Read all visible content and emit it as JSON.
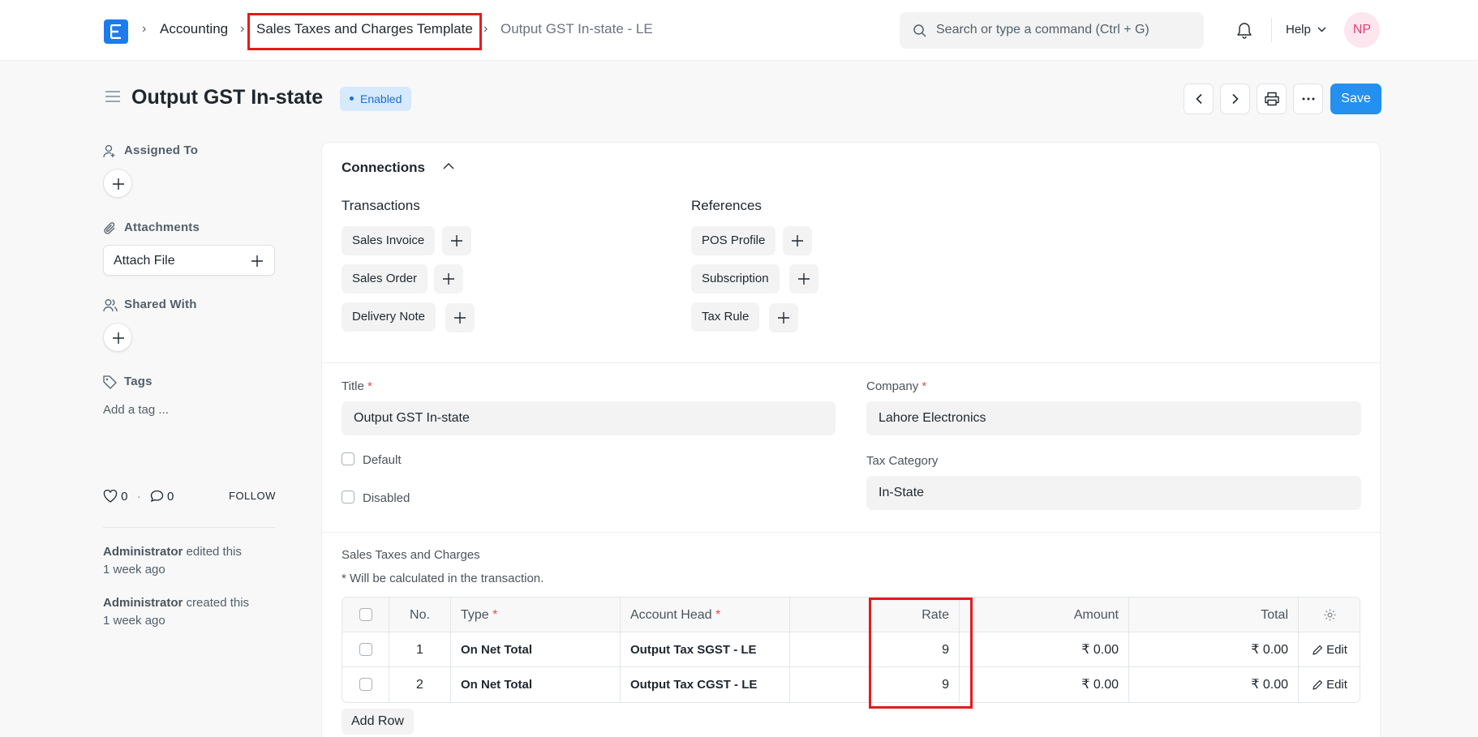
{
  "navbar": {
    "breadcrumbs": [
      "Accounting",
      "Sales Taxes and Charges Template",
      "Output GST In-state - LE"
    ],
    "search_placeholder": "Search or type a command (Ctrl + G)",
    "help_label": "Help",
    "avatar_initials": "NP"
  },
  "header": {
    "title": "Output GST In-state",
    "status": "Enabled",
    "save_label": "Save"
  },
  "sidebar": {
    "assigned_to": "Assigned To",
    "attachments": "Attachments",
    "attach_file": "Attach File",
    "shared_with": "Shared With",
    "tags": "Tags",
    "add_tag": "Add a tag ...",
    "likes": "0",
    "comments": "0",
    "follow": "FOLLOW",
    "activity": [
      {
        "user": "Administrator",
        "action": "edited this",
        "time": "1 week ago"
      },
      {
        "user": "Administrator",
        "action": "created this",
        "time": "1 week ago"
      }
    ]
  },
  "connections": {
    "title": "Connections",
    "transactions_label": "Transactions",
    "transactions": [
      "Sales Invoice",
      "Sales Order",
      "Delivery Note"
    ],
    "references_label": "References",
    "references": [
      "POS Profile",
      "Subscription",
      "Tax Rule"
    ]
  },
  "form": {
    "title_label": "Title",
    "title_value": "Output GST In-state",
    "company_label": "Company",
    "company_value": "Lahore Electronics",
    "default_label": "Default",
    "disabled_label": "Disabled",
    "tax_category_label": "Tax Category",
    "tax_category_value": "In-State"
  },
  "taxes_table": {
    "title": "Sales Taxes and Charges",
    "note": "* Will be calculated in the transaction.",
    "columns": {
      "no": "No.",
      "type": "Type",
      "account_head": "Account Head",
      "rate": "Rate",
      "amount": "Amount",
      "total": "Total"
    },
    "rows": [
      {
        "no": "1",
        "type": "On Net Total",
        "account_head": "Output Tax SGST - LE",
        "rate": "9",
        "amount": "₹ 0.00",
        "total": "₹ 0.00",
        "edit": "Edit"
      },
      {
        "no": "2",
        "type": "On Net Total",
        "account_head": "Output Tax CGST - LE",
        "rate": "9",
        "amount": "₹ 0.00",
        "total": "₹ 0.00",
        "edit": "Edit"
      }
    ],
    "add_row": "Add Row"
  },
  "colors": {
    "accent": "#2490ef",
    "highlight": "#e51b1b",
    "badge_bg": "#d6e9fd"
  }
}
